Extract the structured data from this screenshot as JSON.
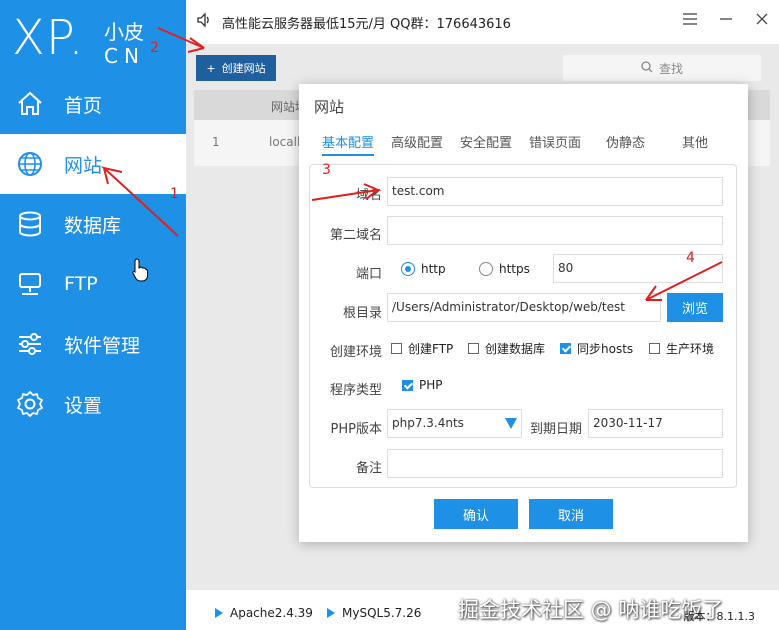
{
  "logo": {
    "xp": "XP.",
    "xiaopi": "小皮",
    "cn": "CN"
  },
  "sidebar": {
    "items": [
      {
        "label": "首页",
        "icon": "home-icon"
      },
      {
        "label": "网站",
        "icon": "globe-icon"
      },
      {
        "label": "数据库",
        "icon": "database-icon"
      },
      {
        "label": "FTP",
        "icon": "ftp-icon"
      },
      {
        "label": "软件管理",
        "icon": "sliders-icon"
      },
      {
        "label": "设置",
        "icon": "gear-icon"
      }
    ],
    "active_index": 1
  },
  "topbar": {
    "message": "高性能云服务器最低15元/月  QQ群：176643616"
  },
  "toolbar": {
    "create_label": "创建网站",
    "search_placeholder": "查找"
  },
  "table": {
    "header_site": "网站域",
    "rows": [
      {
        "index": "1",
        "domain": "locall"
      }
    ]
  },
  "dialog": {
    "title": "网站",
    "tabs": [
      "基本配置",
      "高级配置",
      "安全配置",
      "错误页面",
      "伪静态",
      "其他"
    ],
    "active_tab": 0,
    "form": {
      "domain_label": "域名",
      "domain_value": "test.com",
      "domain2_label": "第二域名",
      "domain2_value": "",
      "port_label": "端口",
      "port_http": "http",
      "port_https": "https",
      "port_value": "80",
      "root_label": "根目录",
      "root_value": "/Users/Administrator/Desktop/web/test",
      "browse_label": "浏览",
      "env_label": "创建环境",
      "env_options": [
        {
          "label": "创建FTP",
          "checked": false
        },
        {
          "label": "创建数据库",
          "checked": false
        },
        {
          "label": "同步hosts",
          "checked": true
        },
        {
          "label": "生产环境",
          "checked": false
        }
      ],
      "program_label": "程序类型",
      "program_option": {
        "label": "PHP",
        "checked": true
      },
      "php_label": "PHP版本",
      "php_value": "php7.3.4nts",
      "expire_label": "到期日期",
      "expire_value": "2030-11-17",
      "note_label": "备注",
      "note_value": ""
    },
    "confirm_label": "确认",
    "cancel_label": "取消"
  },
  "bottombar": {
    "services": [
      "Apache2.4.39",
      "MySQL5.7.26"
    ],
    "watermark": "掘金技术社区 @ 呐谁吃饭了",
    "version": "版本：8.1.1.3"
  },
  "annotations": [
    "1",
    "2",
    "3",
    "4"
  ],
  "colors": {
    "brand": "#1e90e6",
    "annotation": "#e02020",
    "dark_button": "#1f5f9e"
  }
}
